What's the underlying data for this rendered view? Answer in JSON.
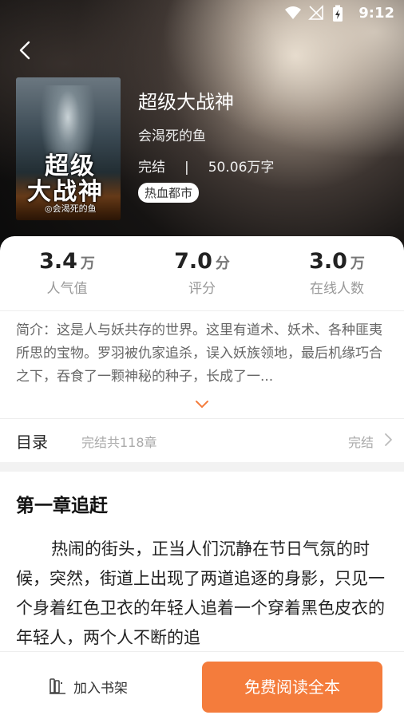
{
  "status_bar": {
    "time": "9:12",
    "icons": [
      "wifi-icon",
      "no-signal-icon",
      "battery-charging-icon"
    ]
  },
  "book": {
    "title": "超级大战神",
    "author": "会渴死的鱼",
    "status": "完结",
    "separator": "|",
    "word_count": "50.06万字",
    "tag": "热血都市",
    "cover": {
      "title_line1": "超级",
      "title_line2": "大战神",
      "author": "◎会渴死的鱼"
    }
  },
  "stats": [
    {
      "value": "3.4",
      "unit": "万",
      "label": "人气值"
    },
    {
      "value": "7.0",
      "unit": "分",
      "label": "评分"
    },
    {
      "value": "3.0",
      "unit": "万",
      "label": "在线人数"
    }
  ],
  "intro": "简介：这是人与妖共存的世界。这里有道术、妖术、各种匪夷所思的宝物。罗羽被仇家追杀，误入妖族领地，最后机缘巧合之下，吞食了一颗神秘的种子，长成了一...",
  "catalog": {
    "heading": "目录",
    "count": "完结共118章",
    "status": "完结"
  },
  "chapter": {
    "title": "第一章追赶",
    "text": "热闹的街头，正当人们沉静在节日气氛的时候，突然，街道上出现了两道追逐的身影，只见一个身着红色卫衣的年轻人追着一个穿着黑色皮衣的年轻人，两个人不断的追"
  },
  "bottom_bar": {
    "shelf_label": "加入书架",
    "read_label": "免费阅读全本"
  },
  "colors": {
    "accent": "#f47c3c",
    "muted_text": "#999999"
  }
}
